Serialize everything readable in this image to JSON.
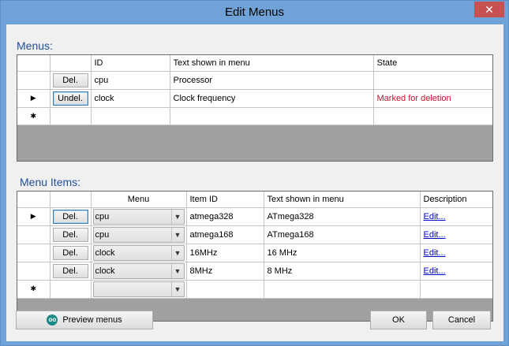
{
  "window": {
    "title": "Edit Menus",
    "close_glyph": "✕"
  },
  "menus": {
    "label": "Menus:",
    "columns": [
      "ID",
      "Text shown in menu",
      "State"
    ],
    "rows": [
      {
        "marker": "",
        "button": "Del.",
        "id": "cpu",
        "text": "Processor",
        "state": ""
      },
      {
        "marker": "▶",
        "button": "Undel.",
        "id": "clock",
        "text": "Clock frequency",
        "state": "Marked for deletion"
      }
    ],
    "new_row_marker": "✱"
  },
  "items": {
    "label": "Menu Items:",
    "columns": [
      "Menu",
      "Item ID",
      "Text shown in menu",
      "Description"
    ],
    "rows": [
      {
        "marker": "▶",
        "button": "Del.",
        "menu": "cpu",
        "item_id": "atmega328",
        "text": "ATmega328",
        "desc": "Edit..."
      },
      {
        "marker": "",
        "button": "Del.",
        "menu": "cpu",
        "item_id": "atmega168",
        "text": "ATmega168",
        "desc": "Edit..."
      },
      {
        "marker": "",
        "button": "Del.",
        "menu": "clock",
        "item_id": "16MHz",
        "text": "16 MHz",
        "desc": "Edit..."
      },
      {
        "marker": "",
        "button": "Del.",
        "menu": "clock",
        "item_id": "8MHz",
        "text": "8 MHz",
        "desc": "Edit..."
      }
    ],
    "new_row_marker": "✱",
    "combo_arrow": "▼"
  },
  "buttons": {
    "preview": "Preview menus",
    "ok": "OK",
    "cancel": "Cancel"
  },
  "colors": {
    "title_bar": "#6fa3d8",
    "section_label": "#1f4e99",
    "state_warning": "#c8102e",
    "close_button": "#c75050"
  }
}
